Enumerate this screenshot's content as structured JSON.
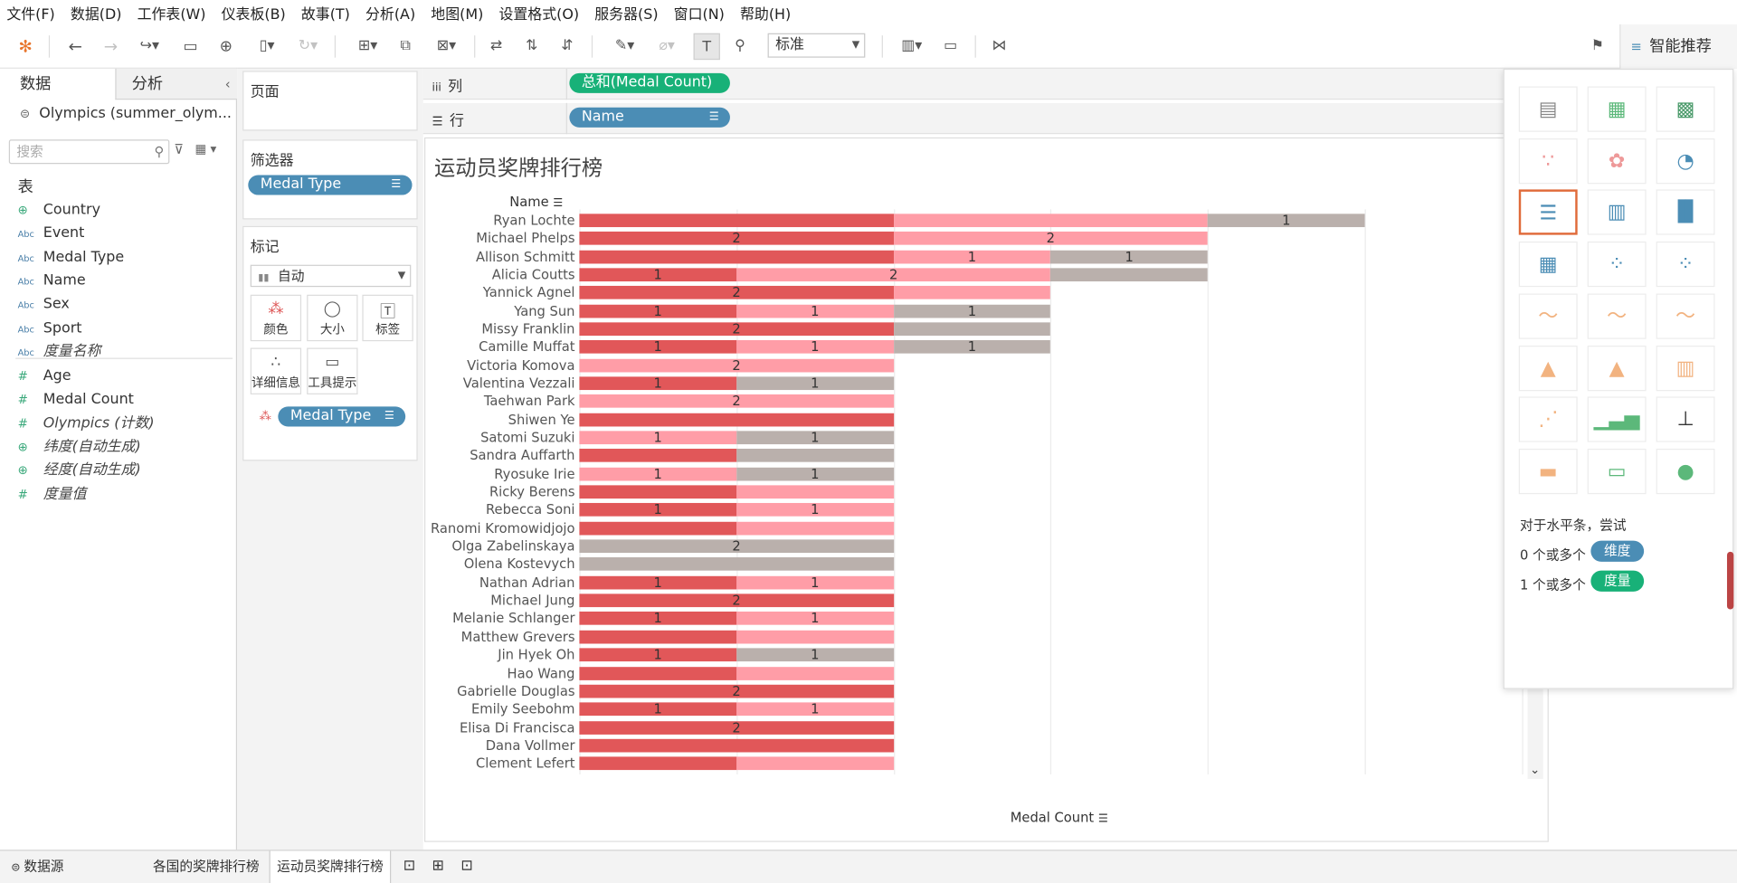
{
  "menu": [
    "文件(F)",
    "数据(D)",
    "工作表(W)",
    "仪表板(B)",
    "故事(T)",
    "分析(A)",
    "地图(M)",
    "设置格式(O)",
    "服务器(S)",
    "窗口(N)",
    "帮助(H)"
  ],
  "toolbar": {
    "fit_value": "标准",
    "show_me_label": "智能推荐"
  },
  "data_pane": {
    "tab_data": "数据",
    "tab_analysis": "分析",
    "datasource": "Olympics (summer_olym...",
    "search_placeholder": "搜索",
    "tables_heading": "表",
    "dimensions": [
      {
        "icon": "globe-icon",
        "label": "Country"
      },
      {
        "icon": "abc-icon",
        "label": "Event"
      },
      {
        "icon": "abc-icon",
        "label": "Medal Type"
      },
      {
        "icon": "abc-icon",
        "label": "Name"
      },
      {
        "icon": "abc-icon",
        "label": "Sex"
      },
      {
        "icon": "abc-icon",
        "label": "Sport"
      },
      {
        "icon": "abc-icon",
        "label": "度量名称"
      }
    ],
    "measures": [
      {
        "icon": "hash-icon",
        "label": "Age"
      },
      {
        "icon": "hash-icon",
        "label": "Medal Count"
      },
      {
        "icon": "hash-icon",
        "label": "Olympics (计数)"
      },
      {
        "icon": "globe-icon",
        "label": "纬度(自动生成)"
      },
      {
        "icon": "globe-icon",
        "label": "经度(自动生成)"
      },
      {
        "icon": "hash-icon",
        "label": "度量值"
      }
    ]
  },
  "cards": {
    "pages_title": "页面",
    "filters_title": "筛选器",
    "filter_pill": "Medal Type",
    "marks_title": "标记",
    "mark_type": "自动",
    "mark_buttons": [
      "颜色",
      "大小",
      "标签",
      "详细信息",
      "工具提示"
    ],
    "marks_pill": "Medal Type"
  },
  "shelves": {
    "columns_label": "列",
    "columns_pill": "总和(Medal Count)",
    "rows_label": "行",
    "rows_pill": "Name"
  },
  "colors": {
    "gold": "#e15759",
    "silver": "#ff9da7",
    "bronze": "#bab0ac",
    "dimension": "#4b8db5",
    "measure": "#18b178"
  },
  "chart_data": {
    "type": "bar",
    "orientation": "horizontal-stacked",
    "title": "运动员奖牌排行榜",
    "row_header": "Name",
    "xlabel": "Medal Count",
    "xlim": [
      0,
      6
    ],
    "xticks": [
      "0",
      "1",
      "2",
      "3",
      "4",
      "5",
      "6"
    ],
    "rows": [
      {
        "name": "Ryan Lochte",
        "segments": [
          {
            "color": "gold",
            "value": 2,
            "label": ""
          },
          {
            "color": "silver",
            "value": 2,
            "label": ""
          },
          {
            "color": "bronze",
            "value": 1,
            "label": "1"
          }
        ]
      },
      {
        "name": "Michael Phelps",
        "segments": [
          {
            "color": "gold",
            "value": 2,
            "label": "2"
          },
          {
            "color": "silver",
            "value": 2,
            "label": "2"
          }
        ]
      },
      {
        "name": "Allison Schmitt",
        "segments": [
          {
            "color": "gold",
            "value": 2,
            "label": ""
          },
          {
            "color": "silver",
            "value": 1,
            "label": "1"
          },
          {
            "color": "bronze",
            "value": 1,
            "label": "1"
          }
        ]
      },
      {
        "name": "Alicia Coutts",
        "segments": [
          {
            "color": "gold",
            "value": 1,
            "label": "1"
          },
          {
            "color": "silver",
            "value": 2,
            "label": "2"
          },
          {
            "color": "bronze",
            "value": 1,
            "label": ""
          }
        ]
      },
      {
        "name": "Yannick Agnel",
        "segments": [
          {
            "color": "gold",
            "value": 2,
            "label": "2"
          },
          {
            "color": "silver",
            "value": 1,
            "label": ""
          }
        ]
      },
      {
        "name": "Yang Sun",
        "segments": [
          {
            "color": "gold",
            "value": 1,
            "label": "1"
          },
          {
            "color": "silver",
            "value": 1,
            "label": "1"
          },
          {
            "color": "bronze",
            "value": 1,
            "label": "1"
          }
        ]
      },
      {
        "name": "Missy Franklin",
        "segments": [
          {
            "color": "gold",
            "value": 2,
            "label": "2"
          },
          {
            "color": "bronze",
            "value": 1,
            "label": ""
          }
        ]
      },
      {
        "name": "Camille Muffat",
        "segments": [
          {
            "color": "gold",
            "value": 1,
            "label": "1"
          },
          {
            "color": "silver",
            "value": 1,
            "label": "1"
          },
          {
            "color": "bronze",
            "value": 1,
            "label": "1"
          }
        ]
      },
      {
        "name": "Victoria Komova",
        "segments": [
          {
            "color": "silver",
            "value": 2,
            "label": "2"
          }
        ]
      },
      {
        "name": "Valentina Vezzali",
        "segments": [
          {
            "color": "gold",
            "value": 1,
            "label": "1"
          },
          {
            "color": "bronze",
            "value": 1,
            "label": "1"
          }
        ]
      },
      {
        "name": "Taehwan Park",
        "segments": [
          {
            "color": "silver",
            "value": 2,
            "label": "2"
          }
        ]
      },
      {
        "name": "Shiwen Ye",
        "segments": [
          {
            "color": "gold",
            "value": 2,
            "label": ""
          }
        ]
      },
      {
        "name": "Satomi Suzuki",
        "segments": [
          {
            "color": "silver",
            "value": 1,
            "label": "1"
          },
          {
            "color": "bronze",
            "value": 1,
            "label": "1"
          }
        ]
      },
      {
        "name": "Sandra Auffarth",
        "segments": [
          {
            "color": "gold",
            "value": 1,
            "label": ""
          },
          {
            "color": "bronze",
            "value": 1,
            "label": ""
          }
        ]
      },
      {
        "name": "Ryosuke Irie",
        "segments": [
          {
            "color": "silver",
            "value": 1,
            "label": "1"
          },
          {
            "color": "bronze",
            "value": 1,
            "label": "1"
          }
        ]
      },
      {
        "name": "Ricky Berens",
        "segments": [
          {
            "color": "gold",
            "value": 1,
            "label": ""
          },
          {
            "color": "silver",
            "value": 1,
            "label": ""
          }
        ]
      },
      {
        "name": "Rebecca Soni",
        "segments": [
          {
            "color": "gold",
            "value": 1,
            "label": "1"
          },
          {
            "color": "silver",
            "value": 1,
            "label": "1"
          }
        ]
      },
      {
        "name": "Ranomi Kromowidjojo",
        "segments": [
          {
            "color": "gold",
            "value": 1,
            "label": ""
          },
          {
            "color": "silver",
            "value": 1,
            "label": ""
          }
        ]
      },
      {
        "name": "Olga Zabelinskaya",
        "segments": [
          {
            "color": "bronze",
            "value": 2,
            "label": "2"
          }
        ]
      },
      {
        "name": "Olena Kostevych",
        "segments": [
          {
            "color": "bronze",
            "value": 2,
            "label": ""
          }
        ]
      },
      {
        "name": "Nathan Adrian",
        "segments": [
          {
            "color": "gold",
            "value": 1,
            "label": "1"
          },
          {
            "color": "silver",
            "value": 1,
            "label": "1"
          }
        ]
      },
      {
        "name": "Michael Jung",
        "segments": [
          {
            "color": "gold",
            "value": 2,
            "label": "2"
          }
        ]
      },
      {
        "name": "Melanie Schlanger",
        "segments": [
          {
            "color": "gold",
            "value": 1,
            "label": "1"
          },
          {
            "color": "silver",
            "value": 1,
            "label": "1"
          }
        ]
      },
      {
        "name": "Matthew Grevers",
        "segments": [
          {
            "color": "gold",
            "value": 1,
            "label": ""
          },
          {
            "color": "silver",
            "value": 1,
            "label": ""
          }
        ]
      },
      {
        "name": "Jin Hyek Oh",
        "segments": [
          {
            "color": "gold",
            "value": 1,
            "label": "1"
          },
          {
            "color": "bronze",
            "value": 1,
            "label": "1"
          }
        ]
      },
      {
        "name": "Hao Wang",
        "segments": [
          {
            "color": "gold",
            "value": 1,
            "label": ""
          },
          {
            "color": "silver",
            "value": 1,
            "label": ""
          }
        ]
      },
      {
        "name": "Gabrielle Douglas",
        "segments": [
          {
            "color": "gold",
            "value": 2,
            "label": "2"
          }
        ]
      },
      {
        "name": "Emily Seebohm",
        "segments": [
          {
            "color": "gold",
            "value": 1,
            "label": "1"
          },
          {
            "color": "silver",
            "value": 1,
            "label": "1"
          }
        ]
      },
      {
        "name": "Elisa Di Francisca",
        "segments": [
          {
            "color": "gold",
            "value": 2,
            "label": "2"
          }
        ]
      },
      {
        "name": "Dana Vollmer",
        "segments": [
          {
            "color": "gold",
            "value": 2,
            "label": ""
          }
        ]
      },
      {
        "name": "Clement Lefert",
        "segments": [
          {
            "color": "gold",
            "value": 1,
            "label": ""
          },
          {
            "color": "silver",
            "value": 1,
            "label": ""
          }
        ]
      }
    ]
  },
  "show_me": {
    "hint": "对于水平条，尝试",
    "dim_text": "0 个或多个",
    "dim_pill": "维度",
    "measure_text": "1 个或多个",
    "measure_pill": "度量"
  },
  "bottom_tabs": {
    "datasource": "数据源",
    "sheet1": "各国的奖牌排行榜",
    "sheet2": "运动员奖牌排行榜"
  }
}
